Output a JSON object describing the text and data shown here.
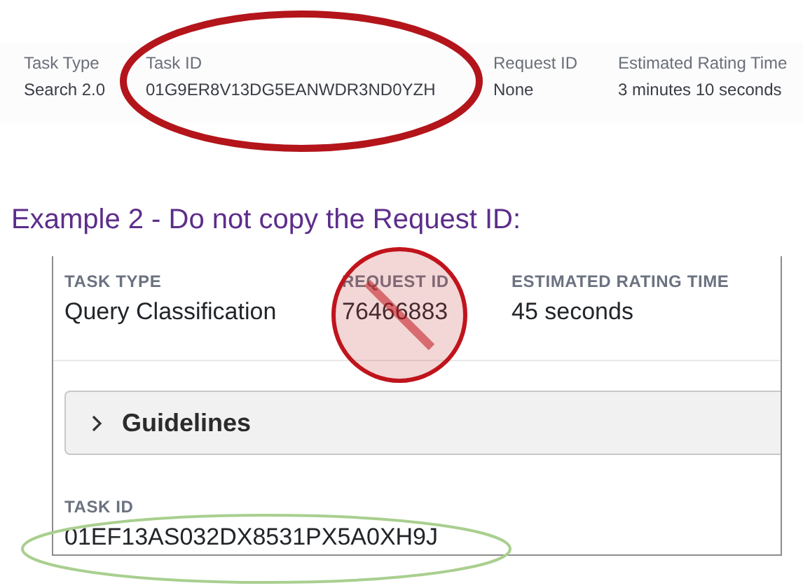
{
  "example_1": {
    "fields": [
      {
        "label": "Task Type",
        "value": "Search 2.0"
      },
      {
        "label": "Task ID",
        "value": "01G9ER8V13DG5EANWDR3ND0YZH"
      },
      {
        "label": "Request ID",
        "value": "None"
      },
      {
        "label": "Estimated Rating Time",
        "value": "3 minutes 10 seconds"
      }
    ]
  },
  "heading": "Example 2 - Do not copy the Request ID:",
  "example_2": {
    "fields": [
      {
        "label": "TASK TYPE",
        "value": "Query Classification"
      },
      {
        "label": "REQUEST ID",
        "value": "76466883"
      },
      {
        "label": "ESTIMATED RATING TIME",
        "value": "45 seconds"
      }
    ],
    "accordion": {
      "label": "Guidelines",
      "expanded": false
    },
    "task_id": {
      "label": "TASK ID",
      "value": "01EF13AS032DX8531PX5A0XH9J"
    }
  }
}
